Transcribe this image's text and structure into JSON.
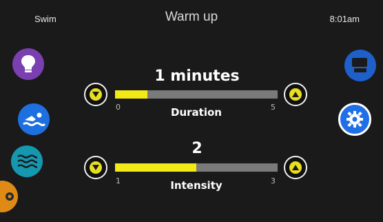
{
  "header": {
    "mode": "Swim",
    "title": "Warm up",
    "time": "8:01am"
  },
  "colors": {
    "accent_yellow": "#f2ea16",
    "track_gray": "#7a7a7a",
    "light_btn": "#7a3fb0",
    "swim_btn": "#1e6fe0",
    "water_btn": "#1597b0",
    "partial_btn": "#e08a16",
    "settings_btn": "#1f6fe6",
    "display_btn": "#1f5fc9"
  },
  "icons": {
    "left": [
      "lightbulb-icon",
      "swimmer-icon",
      "water-waves-icon",
      "gear-icon"
    ],
    "right": [
      "monitor-keyboard-icon",
      "gear-icon"
    ]
  },
  "duration": {
    "value": "1 minutes",
    "label": "Duration",
    "min": "0",
    "max": "5",
    "level": 1,
    "range": [
      0,
      5
    ]
  },
  "intensity": {
    "value": "2",
    "label": "Intensity",
    "min": "1",
    "max": "3",
    "level": 2,
    "range": [
      1,
      3
    ]
  }
}
